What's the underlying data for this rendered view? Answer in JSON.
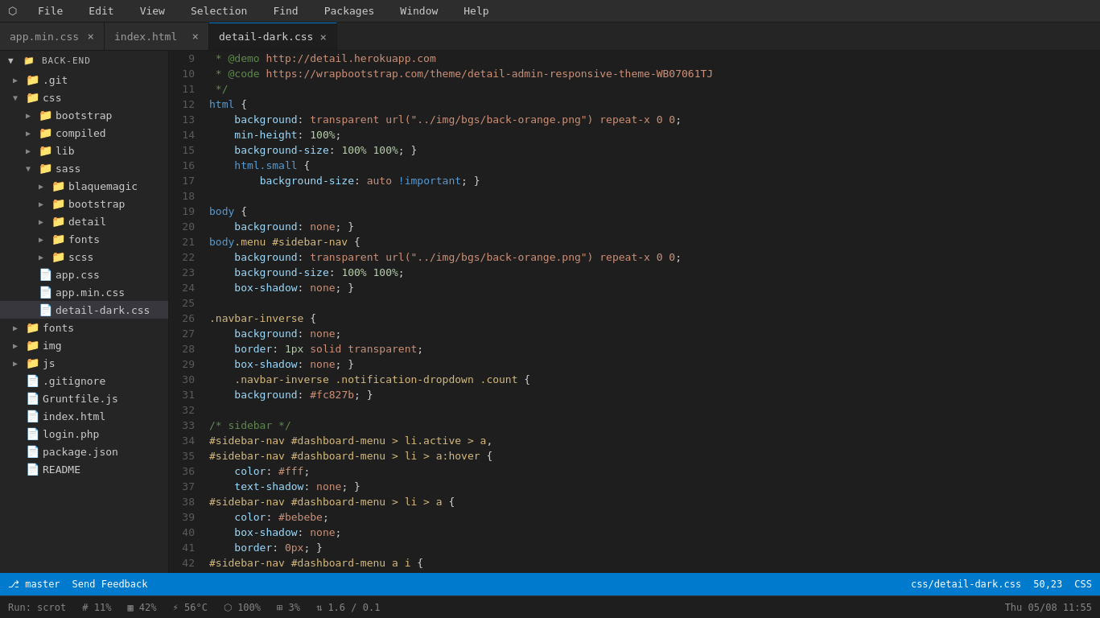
{
  "titlebar": {
    "menus": [
      "File",
      "Edit",
      "View",
      "Selection",
      "Find",
      "Packages",
      "Window",
      "Help"
    ]
  },
  "tabs": [
    {
      "label": "app.min.css",
      "active": false,
      "id": "tab-app-min-css"
    },
    {
      "label": "index.html",
      "active": false,
      "id": "tab-index-html"
    },
    {
      "label": "detail-dark.css",
      "active": true,
      "id": "tab-detail-dark-css"
    }
  ],
  "sidebar": {
    "root": "back-end",
    "items": [
      {
        "indent": 0,
        "type": "folder",
        "label": ".git",
        "expanded": false,
        "arrow": "▶"
      },
      {
        "indent": 0,
        "type": "folder",
        "label": "css",
        "expanded": true,
        "arrow": "▼"
      },
      {
        "indent": 1,
        "type": "folder",
        "label": "bootstrap",
        "expanded": false,
        "arrow": "▶"
      },
      {
        "indent": 1,
        "type": "folder",
        "label": "compiled",
        "expanded": false,
        "arrow": "▶"
      },
      {
        "indent": 1,
        "type": "folder",
        "label": "lib",
        "expanded": false,
        "arrow": "▶"
      },
      {
        "indent": 1,
        "type": "folder",
        "label": "sass",
        "expanded": true,
        "arrow": "▼"
      },
      {
        "indent": 2,
        "type": "folder",
        "label": "blaquemagic",
        "expanded": false,
        "arrow": "▶"
      },
      {
        "indent": 2,
        "type": "folder",
        "label": "bootstrap",
        "expanded": false,
        "arrow": "▶"
      },
      {
        "indent": 2,
        "type": "folder",
        "label": "detail",
        "expanded": false,
        "arrow": "▶"
      },
      {
        "indent": 2,
        "type": "folder",
        "label": "fonts",
        "expanded": false,
        "arrow": "▶"
      },
      {
        "indent": 2,
        "type": "folder",
        "label": "scss",
        "expanded": false,
        "arrow": "▶"
      },
      {
        "indent": 1,
        "type": "css",
        "label": "app.css",
        "arrow": ""
      },
      {
        "indent": 1,
        "type": "css",
        "label": "app.min.css",
        "arrow": ""
      },
      {
        "indent": 1,
        "type": "css",
        "label": "detail-dark.css",
        "arrow": "",
        "selected": true
      },
      {
        "indent": 0,
        "type": "folder",
        "label": "fonts",
        "expanded": false,
        "arrow": "▶"
      },
      {
        "indent": 0,
        "type": "folder",
        "label": "img",
        "expanded": false,
        "arrow": "▶"
      },
      {
        "indent": 0,
        "type": "folder",
        "label": "js",
        "expanded": false,
        "arrow": "▶"
      },
      {
        "indent": 0,
        "type": "file",
        "label": ".gitignore",
        "arrow": ""
      },
      {
        "indent": 0,
        "type": "js",
        "label": "Gruntfile.js",
        "arrow": ""
      },
      {
        "indent": 0,
        "type": "html",
        "label": "index.html",
        "arrow": ""
      },
      {
        "indent": 0,
        "type": "php",
        "label": "login.php",
        "arrow": ""
      },
      {
        "indent": 0,
        "type": "json",
        "label": "package.json",
        "arrow": ""
      },
      {
        "indent": 0,
        "type": "file",
        "label": "README",
        "arrow": ""
      }
    ]
  },
  "editor": {
    "filename": "detail-dark.css",
    "language": "CSS",
    "cursor": "50,23",
    "path": "css/detail-dark.css"
  },
  "statusbar": {
    "branch": "master",
    "feedback": "Send Feedback",
    "path": "css/detail-dark.css",
    "cursor": "50,23",
    "language": "CSS"
  },
  "bottombar": {
    "run": "Run: scrot",
    "percent1": "11%",
    "percent2": "42%",
    "temp": "56°C",
    "battery": "100%",
    "mem": "3%",
    "network": "1.6 / 0.1",
    "datetime": "Thu 05/08 11:55"
  }
}
